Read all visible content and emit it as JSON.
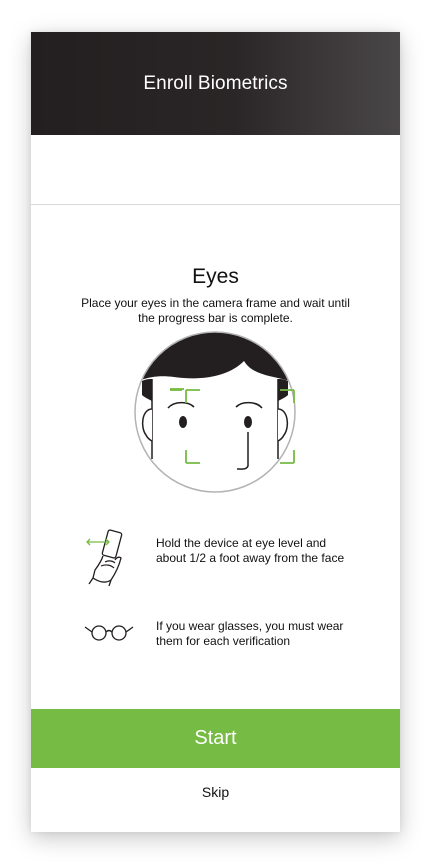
{
  "header": {
    "title": "Enroll Biometrics"
  },
  "section": {
    "title": "Eyes",
    "description": "Place your eyes in the camera frame and wait until the progress bar is complete."
  },
  "tips": [
    {
      "icon": "hand-holding-phone-icon",
      "text": "Hold the device at eye level and about 1/2 a foot away from the face"
    },
    {
      "icon": "glasses-icon",
      "text": "If you wear glasses, you must wear them for each verification"
    }
  ],
  "actions": {
    "start_label": "Start",
    "skip_label": "Skip"
  },
  "colors": {
    "accent": "#76bb43",
    "header_bg": "#231f20"
  }
}
